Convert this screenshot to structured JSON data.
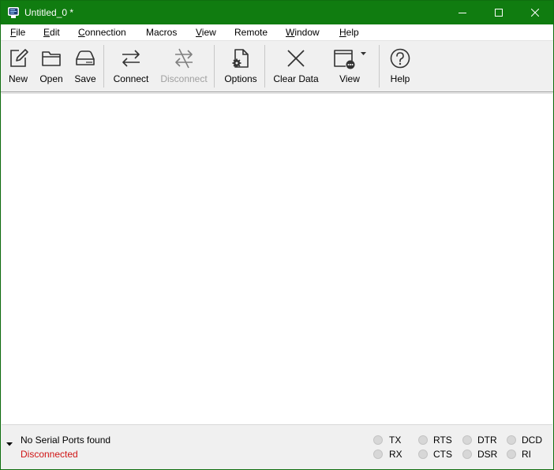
{
  "window": {
    "title": "Untitled_0 *",
    "accent_color": "#107c10",
    "icons": {
      "app": "terminal-monitor-icon",
      "minimize": "minimize-icon",
      "maximize": "maximize-icon",
      "close": "close-icon"
    }
  },
  "menu": {
    "items": [
      {
        "mnemonic": "F",
        "rest": "ile"
      },
      {
        "mnemonic": "E",
        "rest": "dit"
      },
      {
        "mnemonic": "C",
        "rest": "onnection"
      },
      {
        "mnemonic": "",
        "rest": "Macros"
      },
      {
        "mnemonic": "V",
        "rest": "iew"
      },
      {
        "mnemonic": "",
        "rest": "Remote"
      },
      {
        "mnemonic": "W",
        "rest": "indow"
      },
      {
        "mnemonic": "H",
        "rest": "elp"
      }
    ]
  },
  "toolbar": {
    "new": {
      "label": "New",
      "icon": "new-document-icon",
      "enabled": true
    },
    "open": {
      "label": "Open",
      "icon": "folder-open-icon",
      "enabled": true
    },
    "save": {
      "label": "Save",
      "icon": "drive-save-icon",
      "enabled": true
    },
    "connect": {
      "label": "Connect",
      "icon": "connect-arrows-icon",
      "enabled": true
    },
    "disconnect": {
      "label": "Disconnect",
      "icon": "disconnect-arrows-icon",
      "enabled": false
    },
    "options": {
      "label": "Options",
      "icon": "document-gear-icon",
      "enabled": true
    },
    "clear": {
      "label": "Clear Data",
      "icon": "clear-x-icon",
      "enabled": true
    },
    "view": {
      "label": "View",
      "icon": "view-window-dropdown-icon",
      "enabled": true
    },
    "help": {
      "label": "Help",
      "icon": "help-question-icon",
      "enabled": true
    }
  },
  "status": {
    "port_text": "No Serial Ports found",
    "connection_text": "Disconnected",
    "connection_color": "#d01515",
    "toggle_icon": "triangle-down-icon"
  },
  "signals": {
    "tx": "TX",
    "rx": "RX",
    "rts": "RTS",
    "cts": "CTS",
    "dtr": "DTR",
    "dsr": "DSR",
    "dcd": "DCD",
    "ri": "RI",
    "led_color_off": "#d7d7d7"
  }
}
